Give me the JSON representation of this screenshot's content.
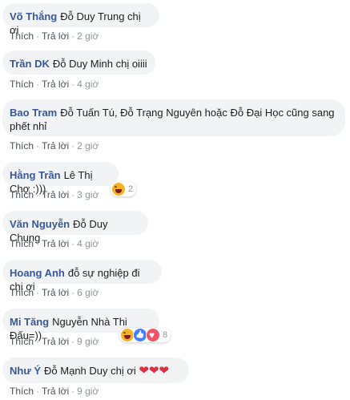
{
  "actions": {
    "like": "Thích",
    "reply": "Trả lời",
    "sep": "·"
  },
  "comments": [
    {
      "author": "Võ Thắng",
      "text": "Đỗ Duy Trung chị ơi",
      "time": "2 giờ"
    },
    {
      "author": "Trần DK",
      "text": "Đỗ Duy Minh chị oiiii",
      "time": "4 giờ"
    },
    {
      "author": "Bao Tram",
      "text": "Đỗ Tuấn Tú, Đỗ Trạng Nguyên hoặc Đỗ Đại Học cũng sang phết nhỉ",
      "time": "2 giờ"
    },
    {
      "author": "Hằng Trần",
      "text": "Lê Thị Chợ :)))",
      "time": "3 giờ",
      "reactions": {
        "icons": [
          "haha-icon"
        ],
        "count": "2"
      }
    },
    {
      "author": "Văn Nguyễn",
      "text": "Đỗ Duy Chung",
      "time": "4 giờ"
    },
    {
      "author": "Hoang Anh",
      "text": "đỗ sự nghiệp đi chị ơi",
      "time": "6 giờ"
    },
    {
      "author": "Mi Tăng",
      "text": "Nguyễn Nhà Thi Đấu=))",
      "time": "9 giờ",
      "reactions": {
        "icons": [
          "haha-icon",
          "like-icon",
          "love-icon"
        ],
        "count": "8"
      }
    },
    {
      "author": "Như Ý",
      "text": "Đỗ Mạnh Duy chị ơi",
      "emoji_text": "❤❤❤",
      "time": "9 giờ"
    }
  ]
}
